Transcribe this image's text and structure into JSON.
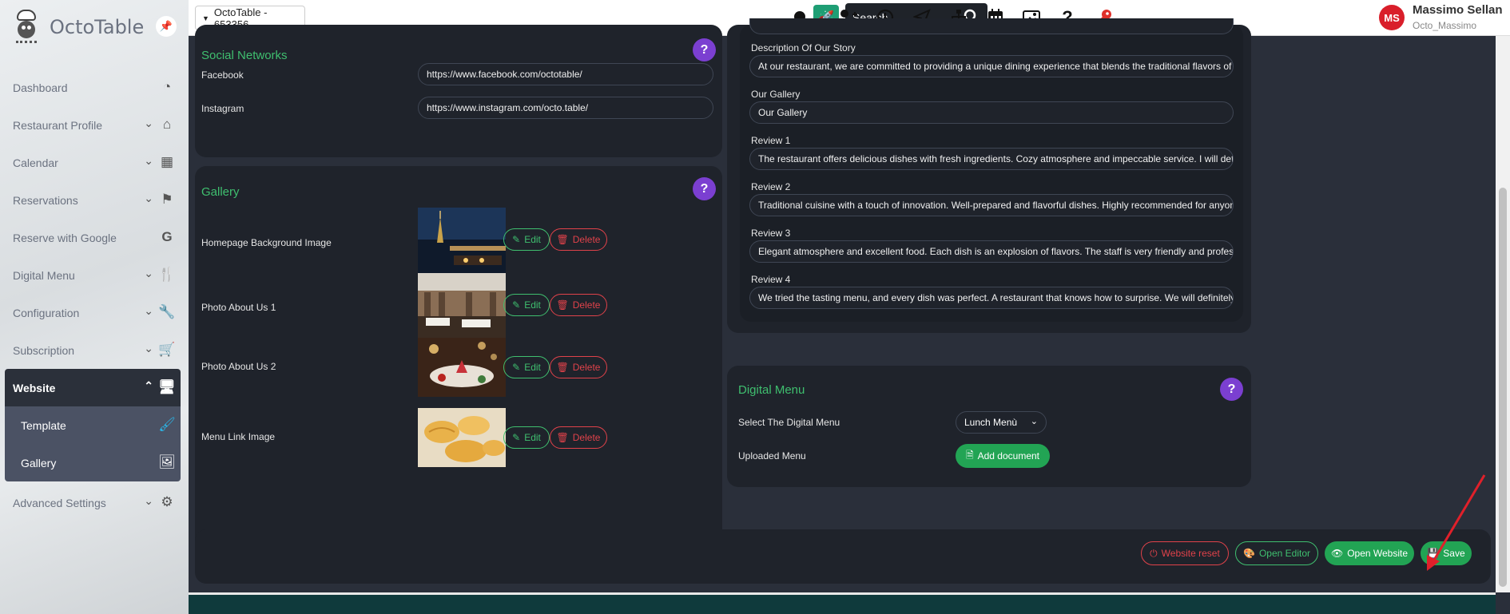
{
  "brand": {
    "name": "OctoTable"
  },
  "sidebar": {
    "items": [
      {
        "label": "Dashboard",
        "icon": "dashboard-gauge-icon"
      },
      {
        "label": "Restaurant Profile",
        "icon": "home-icon"
      },
      {
        "label": "Calendar",
        "icon": "calendar-icon"
      },
      {
        "label": "Reservations",
        "icon": "flag-checkered-icon"
      },
      {
        "label": "Reserve with Google",
        "icon": "google-icon"
      },
      {
        "label": "Digital Menu",
        "icon": "utensils-icon"
      },
      {
        "label": "Configuration",
        "icon": "wrench-icon"
      },
      {
        "label": "Subscription",
        "icon": "cart-icon"
      },
      {
        "label": "Website",
        "icon": "monitor-icon"
      },
      {
        "label": "Advanced Settings",
        "icon": "gears-icon"
      }
    ],
    "website_sub": [
      {
        "label": "Template",
        "icon": "brush-icon"
      },
      {
        "label": "Gallery",
        "icon": "image-icon"
      }
    ]
  },
  "topbar": {
    "tenant": "OctoTable - 653356",
    "search_placeholder": "Search...",
    "user_name": "Massimo Sellan",
    "user_handle": "Octo_Massimo",
    "avatar_initials": "MS"
  },
  "social": {
    "title": "Social Networks",
    "facebook_label": "Facebook",
    "facebook_value": "https://www.facebook.com/octotable/",
    "instagram_label": "Instagram",
    "instagram_value": "https://www.instagram.com/octo.table/"
  },
  "gallery": {
    "title": "Gallery",
    "edit_label": "Edit",
    "delete_label": "Delete",
    "rows": [
      {
        "label": "Homepage Background Image"
      },
      {
        "label": "Photo About Us 1"
      },
      {
        "label": "Photo About Us 2"
      },
      {
        "label": "Menu Link Image"
      }
    ]
  },
  "story": {
    "desc_label": "Description Of Our Story",
    "desc_value": "At our restaurant, we are committed to providing a unique dining experience that blends the traditional flavors of local cuisine with a tou",
    "gallery_label": "Our Gallery",
    "gallery_value": "Our Gallery",
    "reviews": [
      {
        "label": "Review 1",
        "value": "The restaurant offers delicious dishes with fresh ingredients. Cozy atmosphere and impeccable service. I will definitely return!"
      },
      {
        "label": "Review 2",
        "value": "Traditional cuisine with a touch of innovation. Well-prepared and flavorful dishes. Highly recommended for anyone looking for a differen"
      },
      {
        "label": "Review 3",
        "value": "Elegant atmosphere and excellent food. Each dish is an explosion of flavors. The staff is very friendly and professional."
      },
      {
        "label": "Review 4",
        "value": "We tried the tasting menu, and every dish was perfect. A restaurant that knows how to surprise. We will definitely return!"
      }
    ]
  },
  "digital_menu": {
    "title": "Digital Menu",
    "select_label": "Select The Digital Menu",
    "select_value": "Lunch Menù",
    "uploaded_label": "Uploaded Menu",
    "add_doc_label": "Add document"
  },
  "actions": {
    "reset_label": "Website reset",
    "editor_label": "Open Editor",
    "open_label": "Open Website",
    "save_label": "Save"
  },
  "colors": {
    "accent_green": "#22a454",
    "title_green": "#3fbf6f",
    "danger": "#e0424a",
    "help_purple": "#7b3fd1"
  }
}
